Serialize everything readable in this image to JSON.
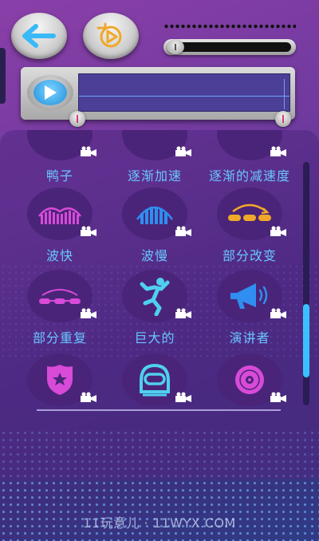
{
  "toolbar": {
    "back_icon": "back-arrow-icon",
    "replay_icon": "replay-icon",
    "volume_icon": "volume-slider"
  },
  "player": {
    "play_icon": "play-icon"
  },
  "effects": {
    "row1": [
      {
        "label": "鸭子"
      },
      {
        "label": "逐渐加速"
      },
      {
        "label": "逐渐的减速度"
      }
    ],
    "row2": [
      {
        "label": "波快",
        "icon": "fast-wave-icon"
      },
      {
        "label": "波慢",
        "icon": "slow-wave-icon"
      },
      {
        "label": "部分改变",
        "icon": "partial-change-icon"
      }
    ],
    "row3": [
      {
        "label": "部分重复",
        "icon": "partial-repeat-icon"
      },
      {
        "label": "巨大的",
        "icon": "giant-icon"
      },
      {
        "label": "演讲者",
        "icon": "megaphone-icon"
      }
    ],
    "row4": [
      {
        "icon": "police-badge-icon"
      },
      {
        "icon": "astronaut-helmet-icon"
      },
      {
        "icon": "vinyl-disc-icon"
      }
    ]
  },
  "watermark": "11玩意儿 · 11WYX.COM",
  "colors": {
    "accent": "#69c6ff",
    "label": "#69c6ff",
    "icon_magenta": "#d84ad8",
    "icon_blue": "#2f8ef0",
    "icon_orange": "#f0a82a",
    "scroll_thumb": "#39c1ff"
  }
}
